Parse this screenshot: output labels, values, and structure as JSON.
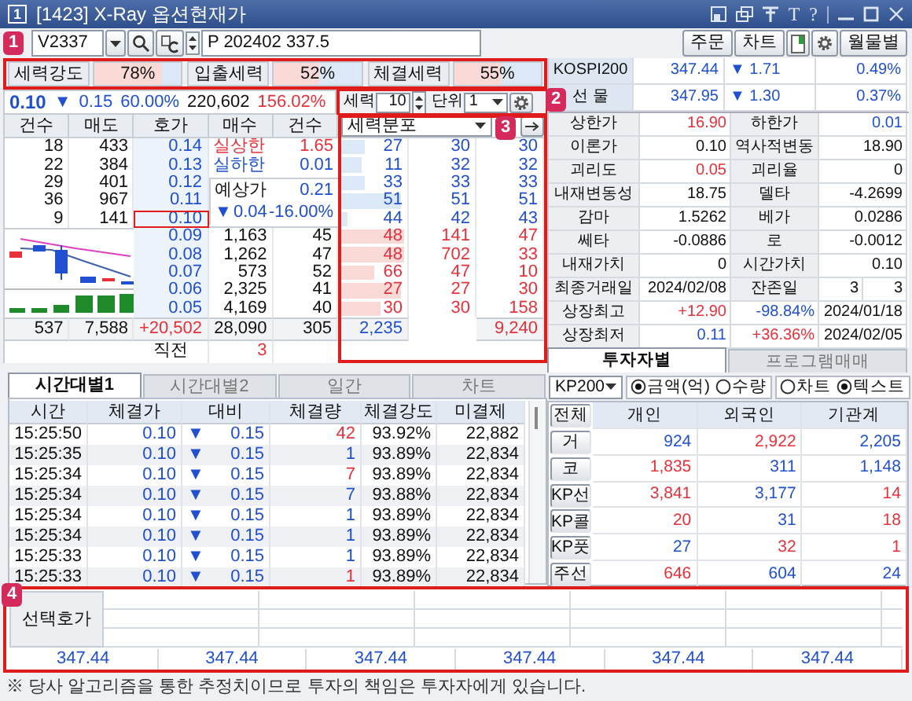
{
  "window": {
    "badge": "1",
    "title": "[1423] X-Ray 옵션현재가",
    "glyphs": [
      "T",
      "?"
    ]
  },
  "toolbar": {
    "code": "V2337",
    "contract": "P 202402 337.5",
    "buttons": [
      "주문",
      "차트",
      "월물별"
    ]
  },
  "strength": [
    {
      "label": "세력강도",
      "value": "78%",
      "level": 0.78
    },
    {
      "label": "입출세력",
      "value": "52%",
      "level": 0.52
    },
    {
      "label": "체결세력",
      "value": "55%",
      "level": 0.55
    }
  ],
  "quote": {
    "price": "0.10",
    "sign": "▼",
    "change": "0.15",
    "rate": "60.00%",
    "volume": "220,602",
    "volume_rate": "156.02%"
  },
  "force_settings": {
    "label": "세력",
    "count": "10",
    "unit_label": "단위",
    "unit": "1"
  },
  "orderbook": {
    "columns": [
      "건수",
      "매도",
      "호가",
      "매수",
      "건수"
    ],
    "asks": [
      {
        "count": "18",
        "volume": "433",
        "price": "0.14",
        "current": false
      },
      {
        "count": "22",
        "volume": "384",
        "price": "0.13",
        "current": false
      },
      {
        "count": "29",
        "volume": "401",
        "price": "0.12",
        "current": false
      },
      {
        "count": "36",
        "volume": "967",
        "price": "0.11",
        "current": false
      },
      {
        "count": "9",
        "volume": "141",
        "price": "0.10",
        "current": true
      }
    ],
    "limits": [
      {
        "label": "실상한",
        "value": "1.65",
        "color": "#e8303a"
      },
      {
        "label": "실하한",
        "value": "0.01",
        "color": "#2050d0"
      }
    ],
    "expected": {
      "label": "예상가",
      "price": "0.21",
      "sign": "▼",
      "change": "0.04",
      "rate": "-16.00%"
    },
    "bids": [
      {
        "price": "0.09",
        "volume": "1,163",
        "count": "45"
      },
      {
        "price": "0.08",
        "volume": "1,262",
        "count": "47"
      },
      {
        "price": "0.07",
        "volume": "573",
        "count": "52"
      },
      {
        "price": "0.06",
        "volume": "2,325",
        "count": "41"
      },
      {
        "price": "0.05",
        "volume": "4,169",
        "count": "40"
      }
    ],
    "totals": [
      "537",
      "7,588",
      "+20,502",
      "28,090",
      "305"
    ],
    "prev": {
      "label": "직전",
      "value": "3"
    }
  },
  "force_dist": {
    "title": "세력분포",
    "asks": [
      {
        "values": [
          "27",
          "30",
          "30"
        ],
        "level": 0.35
      },
      {
        "values": [
          "11",
          "32",
          "32"
        ],
        "level": 0.3
      },
      {
        "values": [
          "33",
          "33",
          "33"
        ],
        "level": 0.35
      },
      {
        "values": [
          "51",
          "51",
          "51"
        ],
        "level": 0.9
      },
      {
        "values": [
          "44",
          "42",
          "43"
        ],
        "level": 0.1
      }
    ],
    "bids": [
      {
        "values": [
          "48",
          "141",
          "47"
        ],
        "level": 0.95
      },
      {
        "values": [
          "48",
          "702",
          "33"
        ],
        "level": 0.95
      },
      {
        "values": [
          "66",
          "47",
          "10"
        ],
        "level": 0.5
      },
      {
        "values": [
          "27",
          "27",
          "30"
        ],
        "level": 0.9
      },
      {
        "values": [
          "30",
          "30",
          "158"
        ],
        "level": 0.6
      }
    ],
    "total_first": "2,235",
    "total_last": "9,240"
  },
  "indices": [
    {
      "label": "KOSPI200",
      "value": "347.44",
      "sign": "▼",
      "change": "1.71",
      "rate": "0.49%"
    },
    {
      "label": "선 물",
      "value": "347.95",
      "sign": "▼",
      "change": "1.30",
      "rate": "0.37%"
    }
  ],
  "info_rows": [
    {
      "cells": [
        {
          "kind": "label",
          "text": "상한가"
        },
        {
          "kind": "value",
          "text": "16.90",
          "color": "#e8303a"
        },
        {
          "kind": "label",
          "text": "하한가"
        },
        {
          "kind": "value",
          "text": "0.01",
          "color": "#2050d0"
        }
      ]
    },
    {
      "cells": [
        {
          "kind": "label",
          "text": "이론가"
        },
        {
          "kind": "value",
          "text": "0.10"
        },
        {
          "kind": "label",
          "text": "역사적변동"
        },
        {
          "kind": "value",
          "text": "18.90"
        }
      ]
    },
    {
      "cells": [
        {
          "kind": "label",
          "text": "괴리도"
        },
        {
          "kind": "value",
          "text": "0.05",
          "color": "#e8303a"
        },
        {
          "kind": "label",
          "text": "괴리율"
        },
        {
          "kind": "value",
          "text": "0"
        }
      ]
    },
    {
      "cells": [
        {
          "kind": "label",
          "text": "내재변동성"
        },
        {
          "kind": "value",
          "text": "18.75"
        },
        {
          "kind": "label",
          "text": "델타"
        },
        {
          "kind": "value",
          "text": "-4.2699"
        }
      ]
    },
    {
      "cells": [
        {
          "kind": "label",
          "text": "감마"
        },
        {
          "kind": "value",
          "text": "1.5262"
        },
        {
          "kind": "label",
          "text": "베가"
        },
        {
          "kind": "value",
          "text": "0.0286"
        }
      ]
    },
    {
      "cells": [
        {
          "kind": "label",
          "text": "쎄타"
        },
        {
          "kind": "value",
          "text": "-0.0886"
        },
        {
          "kind": "label",
          "text": "로"
        },
        {
          "kind": "value",
          "text": "-0.0012"
        }
      ]
    },
    {
      "cells": [
        {
          "kind": "label",
          "text": "내재가치"
        },
        {
          "kind": "value",
          "text": "0"
        },
        {
          "kind": "label",
          "text": "시간가치"
        },
        {
          "kind": "value",
          "text": "0.10"
        }
      ]
    },
    {
      "cells": [
        {
          "kind": "label",
          "text": "최종거래일"
        },
        {
          "kind": "value",
          "text": "2024/02/08"
        },
        {
          "kind": "label",
          "text": "잔존일"
        },
        {
          "kind": "value",
          "text": "3"
        },
        {
          "kind": "value",
          "text": "3"
        }
      ]
    },
    {
      "cells": [
        {
          "kind": "label",
          "text": "상장최고"
        },
        {
          "kind": "value",
          "text": "+12.90",
          "color": "#e8303a"
        },
        {
          "kind": "value",
          "text": "-98.84%",
          "color": "#2050d0"
        },
        {
          "kind": "value",
          "text": "2024/01/18"
        }
      ]
    },
    {
      "cells": [
        {
          "kind": "label",
          "text": "상장최저"
        },
        {
          "kind": "value",
          "text": "0.11",
          "color": "#2050d0"
        },
        {
          "kind": "value",
          "text": "+36.36%",
          "color": "#e8303a"
        },
        {
          "kind": "value",
          "text": "2024/02/05"
        }
      ]
    }
  ],
  "tick_tabs": [
    {
      "label": "시간대별1",
      "selected": true
    },
    {
      "label": "시간대별2",
      "selected": false
    },
    {
      "label": "일간",
      "selected": false
    },
    {
      "label": "차트",
      "selected": false
    }
  ],
  "ticks": {
    "columns": [
      "시간",
      "체결가",
      "대비",
      "체결량",
      "체결강도",
      "미결제"
    ],
    "rows": [
      {
        "time": "15:25:50",
        "price": "0.10",
        "sign": "▼",
        "change": "0.15",
        "volume": {
          "text": "42",
          "color": "#e8303a"
        },
        "strength": "93.92%",
        "open_interest": "22,882"
      },
      {
        "time": "15:25:35",
        "price": "0.10",
        "sign": "▼",
        "change": "0.15",
        "volume": {
          "text": "1",
          "color": "#2050d0"
        },
        "strength": "93.89%",
        "open_interest": "22,834"
      },
      {
        "time": "15:25:34",
        "price": "0.10",
        "sign": "▼",
        "change": "0.15",
        "volume": {
          "text": "7",
          "color": "#e8303a"
        },
        "strength": "93.89%",
        "open_interest": "22,834"
      },
      {
        "time": "15:25:34",
        "price": "0.10",
        "sign": "▼",
        "change": "0.15",
        "volume": {
          "text": "7",
          "color": "#2050d0"
        },
        "strength": "93.88%",
        "open_interest": "22,834"
      },
      {
        "time": "15:25:34",
        "price": "0.10",
        "sign": "▼",
        "change": "0.15",
        "volume": {
          "text": "1",
          "color": "#2050d0"
        },
        "strength": "93.89%",
        "open_interest": "22,834"
      },
      {
        "time": "15:25:34",
        "price": "0.10",
        "sign": "▼",
        "change": "0.15",
        "volume": {
          "text": "1",
          "color": "#2050d0"
        },
        "strength": "93.89%",
        "open_interest": "22,834"
      },
      {
        "time": "15:25:33",
        "price": "0.10",
        "sign": "▼",
        "change": "0.15",
        "volume": {
          "text": "1",
          "color": "#2050d0"
        },
        "strength": "93.89%",
        "open_interest": "22,834"
      },
      {
        "time": "15:25:33",
        "price": "0.10",
        "sign": "▼",
        "change": "0.15",
        "volume": {
          "text": "1",
          "color": "#e8303a"
        },
        "strength": "93.89%",
        "open_interest": "22,834"
      }
    ]
  },
  "investor_tabs": [
    {
      "label": "투자자별",
      "selected": true
    },
    {
      "label": "프로그램매매",
      "selected": false
    }
  ],
  "investor": {
    "market": "KP200",
    "radio_groups": [
      [
        {
          "label": "금액(억)",
          "selected": true
        },
        {
          "label": "수량",
          "selected": false
        }
      ],
      [
        {
          "label": "차트",
          "selected": false
        },
        {
          "label": "텍스트",
          "selected": true
        }
      ]
    ],
    "corner": "전체",
    "columns": [
      "개인",
      "외국인",
      "기관계"
    ],
    "rows": [
      {
        "label": "거",
        "values": [
          {
            "text": "924",
            "color": "#2050d0"
          },
          {
            "text": "2,922",
            "color": "#e8303a"
          },
          {
            "text": "2,205",
            "color": "#2050d0"
          }
        ]
      },
      {
        "label": "코",
        "values": [
          {
            "text": "1,835",
            "color": "#e8303a"
          },
          {
            "text": "311",
            "color": "#2050d0"
          },
          {
            "text": "1,148",
            "color": "#2050d0"
          }
        ]
      },
      {
        "label": "KP선",
        "values": [
          {
            "text": "3,841",
            "color": "#e8303a"
          },
          {
            "text": "3,177",
            "color": "#2050d0"
          },
          {
            "text": "14",
            "color": "#e8303a"
          }
        ]
      },
      {
        "label": "KP콜",
        "values": [
          {
            "text": "20",
            "color": "#e8303a"
          },
          {
            "text": "31",
            "color": "#2050d0"
          },
          {
            "text": "18",
            "color": "#e8303a"
          }
        ]
      },
      {
        "label": "KP풋",
        "values": [
          {
            "text": "27",
            "color": "#2050d0"
          },
          {
            "text": "32",
            "color": "#e8303a"
          },
          {
            "text": "1",
            "color": "#e8303a"
          }
        ]
      },
      {
        "label": "주선",
        "values": [
          {
            "text": "646",
            "color": "#e8303a"
          },
          {
            "text": "604",
            "color": "#2050d0"
          },
          {
            "text": "24",
            "color": "#2050d0"
          }
        ]
      }
    ]
  },
  "selected_quote": {
    "label": "선택호가",
    "prices": [
      "347.44",
      "347.44",
      "347.44",
      "347.44",
      "347.44",
      "347.44"
    ]
  },
  "footer": "※ 당사 알고리즘을 통한 추정치이므로 투자의 책임은 투자자에게 있습니다.",
  "callouts": [
    "1",
    "2",
    "3",
    "4"
  ]
}
